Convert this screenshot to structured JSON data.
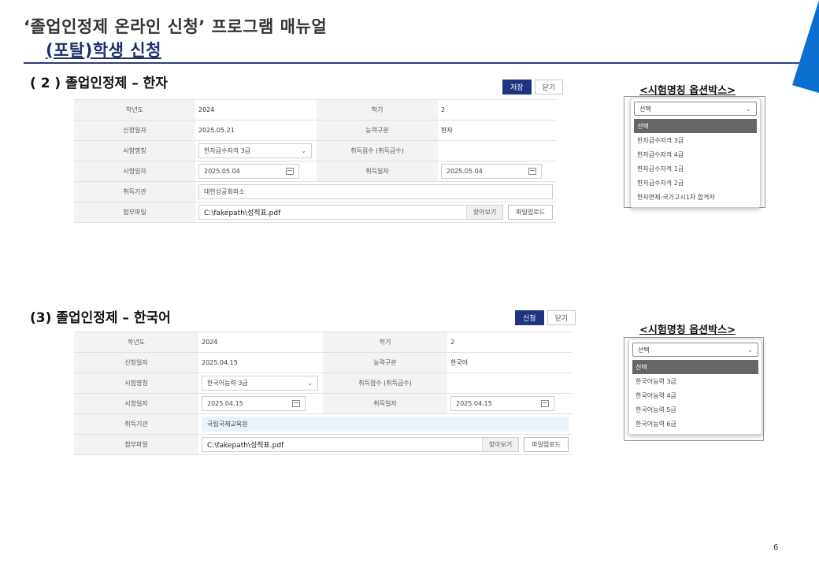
{
  "doc": {
    "title": "‘졸업인정제 온라인 신청’ 프로그램 매뉴얼",
    "subtitle": "(포탈)학생 신청",
    "page_number": "6",
    "accent_color": "#1e3480",
    "corner_color": "#0a6fd1"
  },
  "section_hanja": {
    "heading": "( 2 ) 졸업인정제 – 한자",
    "buttons": {
      "save": "저장",
      "close": "닫기"
    },
    "fields": {
      "year_label": "학년도",
      "year_value": "2024",
      "semester_label": "학기",
      "semester_value": "2",
      "apply_date_label": "신청일자",
      "apply_date_value": "2025.05.21",
      "ability_label": "능력구분",
      "ability_value": "한자",
      "exam_name_label": "시험명칭",
      "exam_name_value": "한자급수자격 3급",
      "score_label": "취득점수 (취득급수)",
      "score_value": "",
      "exam_date_label": "시험일자",
      "exam_date_value": "2025.05.04",
      "acquire_date_label": "취득일자",
      "acquire_date_value": "2025.05.04",
      "org_label": "취득기관",
      "org_value": "대한상공회의소",
      "file_label": "첨부파일",
      "file_value": "C:\\fakepath\\성적표.pdf",
      "browse": "찾아보기",
      "upload": "파일업로드"
    },
    "options": {
      "title": "<시험명칭 옵션박스>",
      "selected": "선택",
      "items": [
        "선택",
        "한자급수자격 3급",
        "한자급수자격 4급",
        "한자급수자격 1급",
        "한자급수자격 2급",
        "한자면제-국가고시1차 합격자"
      ]
    }
  },
  "section_korean": {
    "heading": "(3) 졸업인정제 – 한국어",
    "buttons": {
      "apply": "신청",
      "close": "닫기"
    },
    "fields": {
      "year_label": "학년도",
      "year_value": "2024",
      "semester_label": "학기",
      "semester_value": "2",
      "apply_date_label": "신청일자",
      "apply_date_value": "2025.04.15",
      "ability_label": "능력구분",
      "ability_value": "한국어",
      "exam_name_label": "시험명칭",
      "exam_name_value": "한국어능력 3급",
      "score_label": "취득점수 (취득급수)",
      "score_value": "",
      "exam_date_label": "시험일자",
      "exam_date_value": "2025.04.15",
      "acquire_date_label": "취득일자",
      "acquire_date_value": "2025.04.15",
      "org_label": "취득기관",
      "org_value": "국립국제교육원",
      "file_label": "첨부파일",
      "file_value": "C:\\fakepath\\성적표.pdf",
      "browse": "찾아보기",
      "upload": "파일업로드"
    },
    "options": {
      "title": "<시험명칭 옵션박스>",
      "selected": "선택",
      "items": [
        "선택",
        "한국어능력 3급",
        "한국어능력 4급",
        "한국어능력 5급",
        "한국어능력 6급"
      ]
    }
  }
}
